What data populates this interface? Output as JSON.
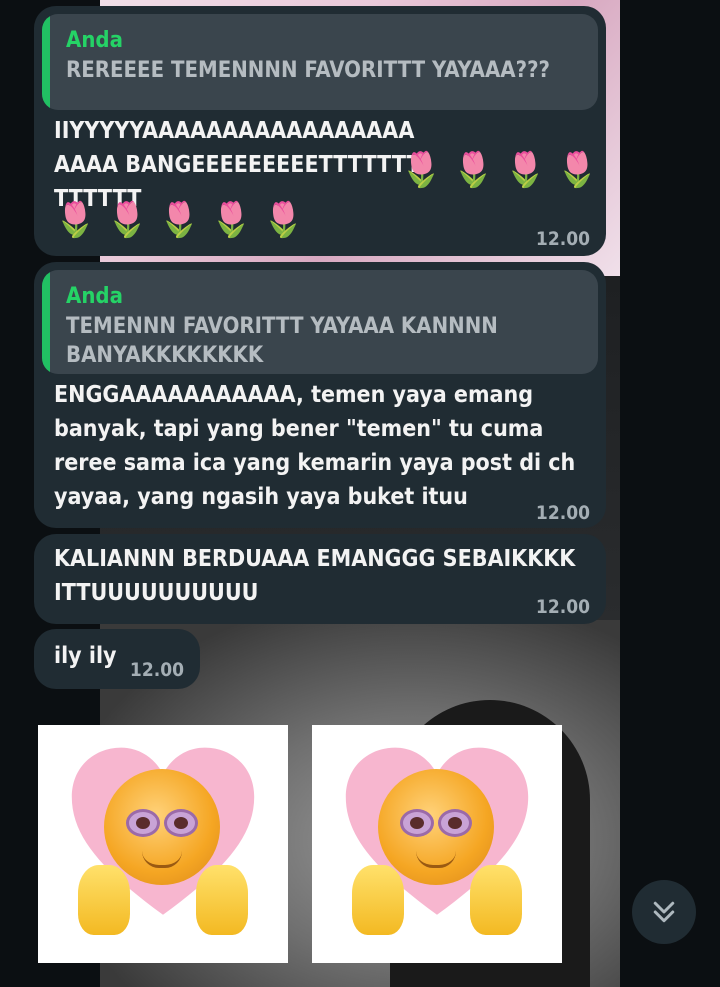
{
  "messages": [
    {
      "quote_author": "Anda",
      "quote_text": "REREEEE TEMENNNN FAVORITTT YAYAAA???",
      "text": "IIYYYYYAAAAAAAAAAAAAAAAAAAAA BANGEEEEEEEEETTTTTTTTTTTTT",
      "emoji_row1": "🌷 🌷 🌷 🌷",
      "emoji_row2": "🌷 🌷 🌷 🌷 🌷",
      "time": "12.00"
    },
    {
      "quote_author": "Anda",
      "quote_text": "TEMENNN FAVORITTT YAYAAA KANNNN BANYAKKKKKKKK",
      "text": "ENGGAAAAAAAAAAA, temen yaya emang banyak, tapi yang bener \"temen\" tu cuma reree sama ica yang kemarin yaya post di ch yayaa, yang ngasih yaya buket ituu",
      "time": "12.00"
    },
    {
      "text": "KALIANNN BERDUAAA EMANGGG SEBAIKKKK ITTUUUUUUUUUU",
      "time": "12.00"
    },
    {
      "text": "ily ily",
      "time": "12.00"
    }
  ],
  "stickers": [
    "love-face-sticker",
    "love-face-sticker"
  ],
  "colors": {
    "bubble_bg": "#202c33",
    "quote_bg": "#3a454d",
    "accent_green": "#25d366",
    "time_gray": "#a4aeb4"
  },
  "icons": {
    "scroll_button": "double-chevron-down-icon"
  }
}
